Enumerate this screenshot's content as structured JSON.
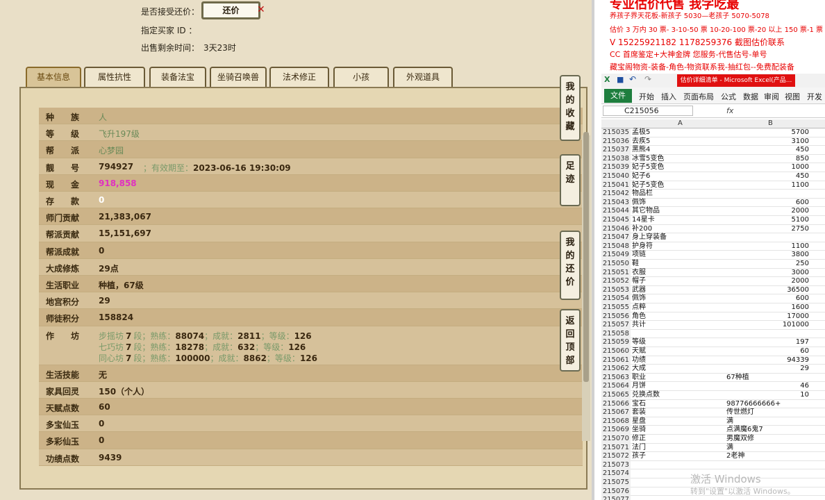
{
  "counter_offer": {
    "accept_label": "是否接受还价：",
    "button_label": "还价",
    "buyer_label": "指定买家 ID ：",
    "remaining_label": "出售剩余时间：",
    "remaining_value": "3天23时"
  },
  "tabs": [
    "基本信息",
    "属性抗性",
    "装备法宝",
    "坐骑召唤兽",
    "法术修正",
    "小孩",
    "外观道具"
  ],
  "side_buttons": [
    "我的收藏",
    "足迹",
    "我的还价",
    "返回顶部"
  ],
  "rows": [
    {
      "label": "种　　族",
      "value": "人",
      "style": "green"
    },
    {
      "label": "等　　级",
      "value": "飞升197级",
      "style": "green"
    },
    {
      "label": "帮　　派",
      "value": "心梦园",
      "style": "green"
    },
    {
      "label": "靓　　号",
      "value": "794927",
      "extra_label": "；有效期至：",
      "extra_value": "2023-06-16 19:30:09"
    },
    {
      "label": "现　　金",
      "value": "918,858",
      "style": "pink"
    },
    {
      "label": "存　　款",
      "value": "0",
      "style": "white"
    },
    {
      "label": "师门贡献",
      "value": "21,383,067"
    },
    {
      "label": "帮派贡献",
      "value": "15,151,697"
    },
    {
      "label": "帮派成就",
      "value": "0"
    },
    {
      "label": "大成修炼",
      "value": "29点"
    },
    {
      "label": "生活职业",
      "value": "种植，67级"
    },
    {
      "label": "地宫积分",
      "value": "29"
    },
    {
      "label": "师徒积分",
      "value": "158824"
    },
    {
      "label": "作　　坊",
      "workshops": [
        {
          "name": "步摇坊",
          "level": "7",
          "exp": "88074",
          "achv": "2811",
          "grade": "126"
        },
        {
          "name": "七巧坊",
          "level": "7",
          "exp": "18278",
          "achv": "632",
          "grade": "126"
        },
        {
          "name": "同心坊",
          "level": "7",
          "exp": "100000",
          "achv": "8862",
          "grade": "126"
        }
      ]
    },
    {
      "label": "生活技能",
      "value": "无"
    },
    {
      "label": "家具回灵",
      "value": "150（个人）"
    },
    {
      "label": "天赋点数",
      "value": "60"
    },
    {
      "label": "多宝仙玉",
      "value": "0"
    },
    {
      "label": "多彩仙玉",
      "value": "0"
    },
    {
      "label": "功绩点数",
      "value": "9439"
    }
  ],
  "workshop_text": {
    "duan": "段；熟练：",
    "achv": "；成就：",
    "grade": "；等级："
  },
  "ad_lines": [
    "专业估价代售 我字吃最",
    "养孩子界天花板-新孩子 5030—老孩子 5070-5078",
    "估价 3 万内 30 票- 3-10-50 票 10-20-100 票-20 以上 150 票-1 票 1",
    "V 15225921182    1178259376  截图估价联系",
    "CC 首席鉴定+大神金牌       您服务-代售估号-单号",
    "藏宝阁物资-装备-角色-物资联系我-抽红包--免费配装备"
  ],
  "excel": {
    "title": "估价详细清单 - Microsoft Excel(产品...",
    "file_tab": "文件",
    "ribbon": [
      "开始",
      "插入",
      "页面布局",
      "公式",
      "数据",
      "审阅",
      "视图",
      "开发工"
    ],
    "name_box": "C215056",
    "fx": "fx",
    "col_a": "A",
    "col_b": "B",
    "rows": [
      {
        "n": "215035",
        "a": "孟极5",
        "b": "5700"
      },
      {
        "n": "215036",
        "a": "去疾5",
        "b": "3100"
      },
      {
        "n": "215037",
        "a": "黑熊4",
        "b": "450"
      },
      {
        "n": "215038",
        "a": "冰雪5变色",
        "b": "850"
      },
      {
        "n": "215039",
        "a": "妃子5变色",
        "b": "1000"
      },
      {
        "n": "215040",
        "a": "妃子6",
        "b": "450"
      },
      {
        "n": "215041",
        "a": "妃子5变色",
        "b": "1100"
      },
      {
        "n": "215042",
        "a": "物品栏",
        "b": ""
      },
      {
        "n": "215043",
        "a": "佩饰",
        "b": "600"
      },
      {
        "n": "215044",
        "a": "其它物品",
        "b": "2000"
      },
      {
        "n": "215045",
        "a": "14星卡",
        "b": "5100"
      },
      {
        "n": "215046",
        "a": "补200",
        "b": "2750"
      },
      {
        "n": "215047",
        "a": "身上穿装备",
        "b": ""
      },
      {
        "n": "215048",
        "a": "护身符",
        "b": "1100"
      },
      {
        "n": "215049",
        "a": "项链",
        "b": "3800"
      },
      {
        "n": "215050",
        "a": "鞋",
        "b": "250"
      },
      {
        "n": "215051",
        "a": "衣服",
        "b": "3000"
      },
      {
        "n": "215052",
        "a": "帽子",
        "b": "2000"
      },
      {
        "n": "215053",
        "a": "武器",
        "b": "36500"
      },
      {
        "n": "215054",
        "a": "佩饰",
        "b": "600"
      },
      {
        "n": "215055",
        "a": "点粹",
        "b": "1600"
      },
      {
        "n": "215056",
        "a": "角色",
        "b": "17000"
      },
      {
        "n": "215057",
        "a": "共计",
        "b": "101000"
      },
      {
        "n": "215058",
        "a": "",
        "b": ""
      },
      {
        "n": "215059",
        "a": "等级",
        "b": "197"
      },
      {
        "n": "215060",
        "a": "天赋",
        "b": "60"
      },
      {
        "n": "215061",
        "a": "功绩",
        "b": "94339"
      },
      {
        "n": "215062",
        "a": "大成",
        "b": "29"
      },
      {
        "n": "215063",
        "a": "职业",
        "b": "67种植",
        "bl": true
      },
      {
        "n": "215064",
        "a": "月饼",
        "b": "46"
      },
      {
        "n": "215065",
        "a": "兑换点数",
        "b": "10"
      },
      {
        "n": "215066",
        "a": "宝石",
        "b": "98776666666+",
        "bl": true
      },
      {
        "n": "215067",
        "a": "套装",
        "b": "传世燃灯",
        "bl": true
      },
      {
        "n": "215068",
        "a": "星盘",
        "b": "满",
        "bl": true
      },
      {
        "n": "215069",
        "a": "坐骑",
        "b": "点满魔6鬼7",
        "bl": true
      },
      {
        "n": "215070",
        "a": "修正",
        "b": "男魔双修",
        "bl": true
      },
      {
        "n": "215071",
        "a": "法门",
        "b": "满",
        "bl": true
      },
      {
        "n": "215072",
        "a": "孩子",
        "b": "2老神",
        "bl": true
      },
      {
        "n": "215073",
        "a": "",
        "b": ""
      },
      {
        "n": "215074",
        "a": "",
        "b": ""
      },
      {
        "n": "215075",
        "a": "",
        "b": ""
      },
      {
        "n": "215076",
        "a": "",
        "b": ""
      },
      {
        "n": "215077",
        "a": "",
        "b": ""
      }
    ]
  },
  "watermark": [
    "激活 Windows",
    "转到\"设置\"以激活 Windows。"
  ]
}
